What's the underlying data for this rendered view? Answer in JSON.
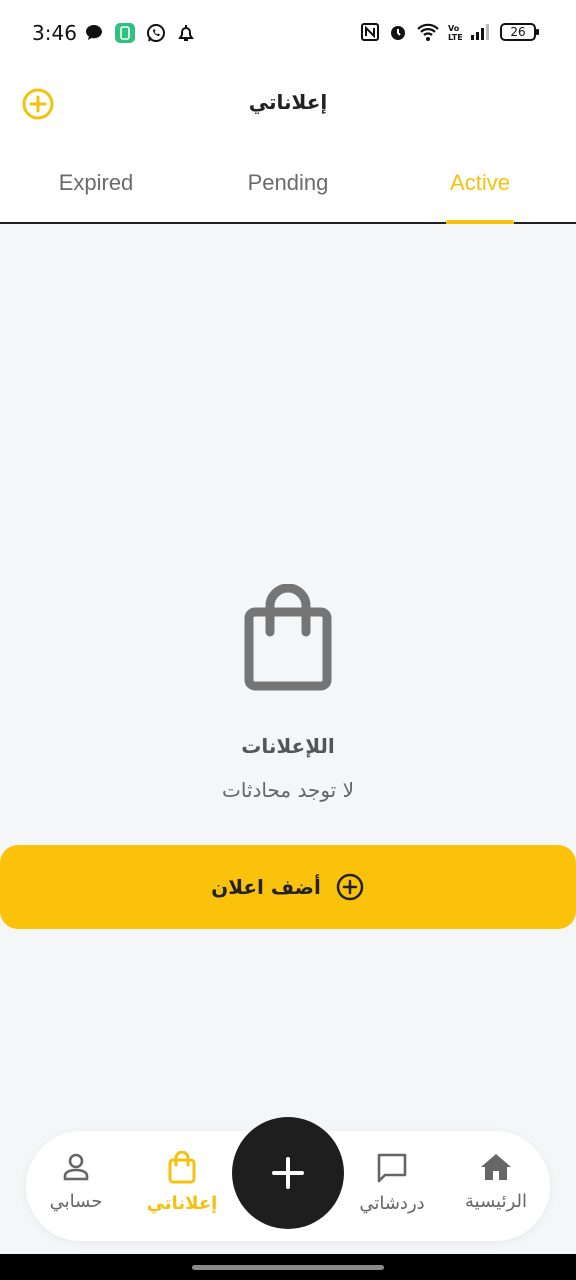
{
  "status_bar": {
    "time": "3:46",
    "battery": "26",
    "icons": [
      "chat-bubble-icon",
      "app-notification-icon",
      "whatsapp-icon",
      "bell-icon",
      "nfc-icon",
      "alarm-icon",
      "wifi-icon",
      "volte-icon",
      "signal-icon",
      "battery-icon"
    ]
  },
  "header": {
    "title": "إعلاناتي",
    "add_icon": "plus-circle-icon"
  },
  "tabs": [
    {
      "label": "Expired",
      "active": false
    },
    {
      "label": "Pending",
      "active": false
    },
    {
      "label": "Active",
      "active": true
    }
  ],
  "empty_state": {
    "icon": "shopping-bag-icon",
    "title": "اللإعلانات",
    "subtitle": "لا توجد محادثات"
  },
  "add_button": {
    "label": "أضف اعلان",
    "icon": "plus-circle-icon"
  },
  "bottom_nav": {
    "items": [
      {
        "label": "الرئيسية",
        "icon": "home-icon",
        "active": false
      },
      {
        "label": "دردشاتي",
        "icon": "chat-icon",
        "active": false
      },
      {
        "label": "إعلاناتي",
        "icon": "shopping-bag-icon",
        "active": true
      },
      {
        "label": "حسابي",
        "icon": "person-icon",
        "active": false
      }
    ],
    "fab_icon": "plus-icon"
  },
  "colors": {
    "accent": "#f5c10e",
    "button": "#fbc20c",
    "background": "#f5f6f8",
    "fab": "#1e1e1e"
  }
}
